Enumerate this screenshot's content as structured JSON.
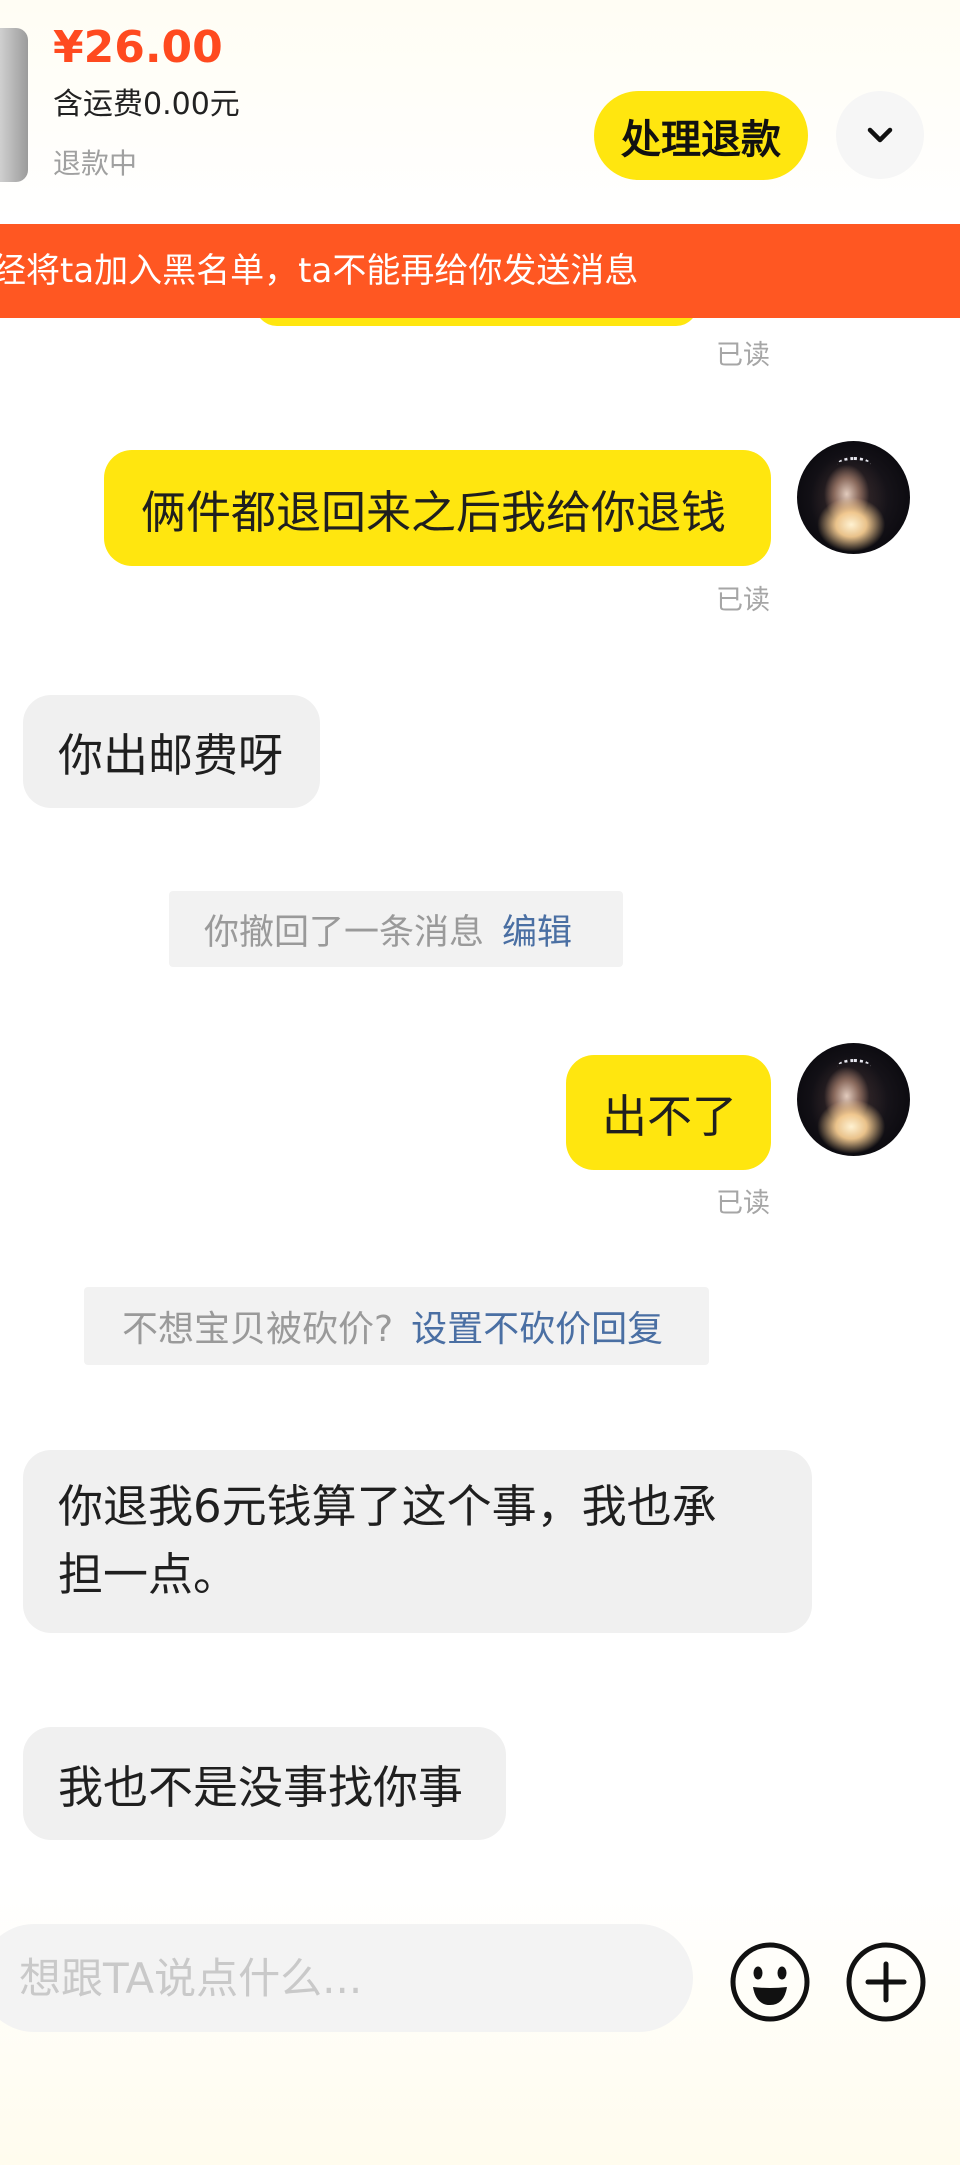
{
  "product": {
    "price": "¥26.00",
    "shipping_note": "含运费0.00元",
    "status": "退款中",
    "action_button_label": "处理退款",
    "expand_icon": "chevron-down-icon"
  },
  "blacklist_banner": {
    "text": "经将ta加入黑名单，ta不能再给你发送消息"
  },
  "thread": [
    {
      "message": {
        "outgoing": true,
        "read_status": "已读"
      }
    },
    {
      "message": {
        "outgoing": true,
        "text": "俩件都退回来之后我给你退钱",
        "read_status": "已读"
      }
    },
    {
      "message": {
        "outgoing": false,
        "text": "你出邮费呀"
      }
    },
    {
      "notice": {
        "text": "你撤回了一条消息",
        "link": "编辑"
      }
    },
    {
      "message": {
        "outgoing": true,
        "text": "出不了",
        "read_status": "已读"
      }
    },
    {
      "notice": {
        "text": "不想宝贝被砍价?",
        "link": "设置不砍价回复"
      }
    },
    {
      "message": {
        "outgoing": false,
        "text": "你退我6元钱算了这个事，我也承担一点。"
      }
    },
    {
      "message": {
        "outgoing": false,
        "text": "我也不是没事找你事"
      }
    }
  ],
  "composer": {
    "placeholder": "想跟TA说点什么...",
    "emoji_icon": "smiley-icon",
    "add_icon": "plus-circle-icon"
  },
  "colors": {
    "accent_yellow": "#FFE60F",
    "banner_red": "#FF5722",
    "price_red": "#FF4A1F",
    "link_blue": "#4A6FA3",
    "incoming_bubble": "#F0F0F0"
  }
}
